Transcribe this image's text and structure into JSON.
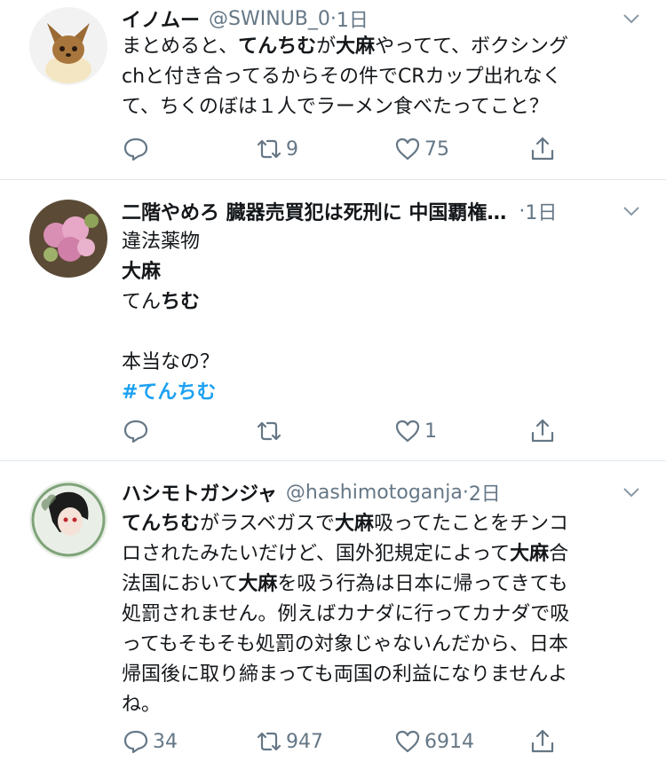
{
  "tweets": [
    {
      "display_name": "イノムー",
      "handle": "@SWINUB_0",
      "dot": "·",
      "time": "1日",
      "lines": [
        [
          {
            "t": "まとめると、"
          },
          {
            "t": "てんちむ",
            "b": true
          },
          {
            "t": "が"
          },
          {
            "t": "大麻",
            "b": true
          },
          {
            "t": "やってて、ボクシング"
          }
        ],
        [
          {
            "t": "chと付き合ってるからその件でCRカップ出れなく"
          }
        ],
        [
          {
            "t": "て、ちくのぼは１人でラーメン食べたってこと？"
          }
        ]
      ],
      "reply_count": "",
      "retweet_count": "9",
      "like_count": "75"
    },
    {
      "display_name": "二階やめろ 臓器売買犯は死刑に 中国覇権…",
      "handle": "",
      "dot": "·",
      "time": "1日",
      "lines": [
        [
          {
            "t": "違法薬物"
          }
        ],
        [
          {
            "t": "大麻",
            "b": true
          }
        ],
        [
          {
            "t": "てん"
          },
          {
            "t": "ちむ",
            "b": true
          }
        ],
        [
          {
            "t": ""
          }
        ],
        [
          {
            "t": "本当なの？"
          }
        ],
        [
          {
            "t": "#てんちむ",
            "tag": true
          }
        ]
      ],
      "reply_count": "",
      "retweet_count": "",
      "like_count": "1"
    },
    {
      "display_name": "ハシモトガンジャ",
      "handle": "@hashimotoganja",
      "dot": "·",
      "time": "2日",
      "lines": [
        [
          {
            "t": "てんちむ",
            "b": true
          },
          {
            "t": "がラスベガスで"
          },
          {
            "t": "大麻",
            "b": true
          },
          {
            "t": "吸ってたことをチンコ"
          }
        ],
        [
          {
            "t": "ロされたみたいだけど、国外犯規定によって"
          },
          {
            "t": "大麻",
            "b": true
          },
          {
            "t": "合"
          }
        ],
        [
          {
            "t": "法国において"
          },
          {
            "t": "大麻",
            "b": true
          },
          {
            "t": "を吸う行為は日本に帰ってきても"
          }
        ],
        [
          {
            "t": "処罰されません。例えばカナダに行ってカナダで吸"
          }
        ],
        [
          {
            "t": "ってもそもそも処罰の対象じゃないんだから、日本"
          }
        ],
        [
          {
            "t": "帰国後に取り締まっても両国の利益になりませんよ"
          }
        ],
        [
          {
            "t": "ね。"
          }
        ]
      ],
      "reply_count": "34",
      "retweet_count": "947",
      "like_count": "6914"
    }
  ],
  "icons": [
    "reply-icon",
    "retweet-icon",
    "like-icon",
    "share-icon",
    "chevron-down-icon"
  ],
  "colors": {
    "text": "#14171a",
    "secondary": "#657786",
    "link": "#1da1f2",
    "divider": "#e1e8ed"
  }
}
